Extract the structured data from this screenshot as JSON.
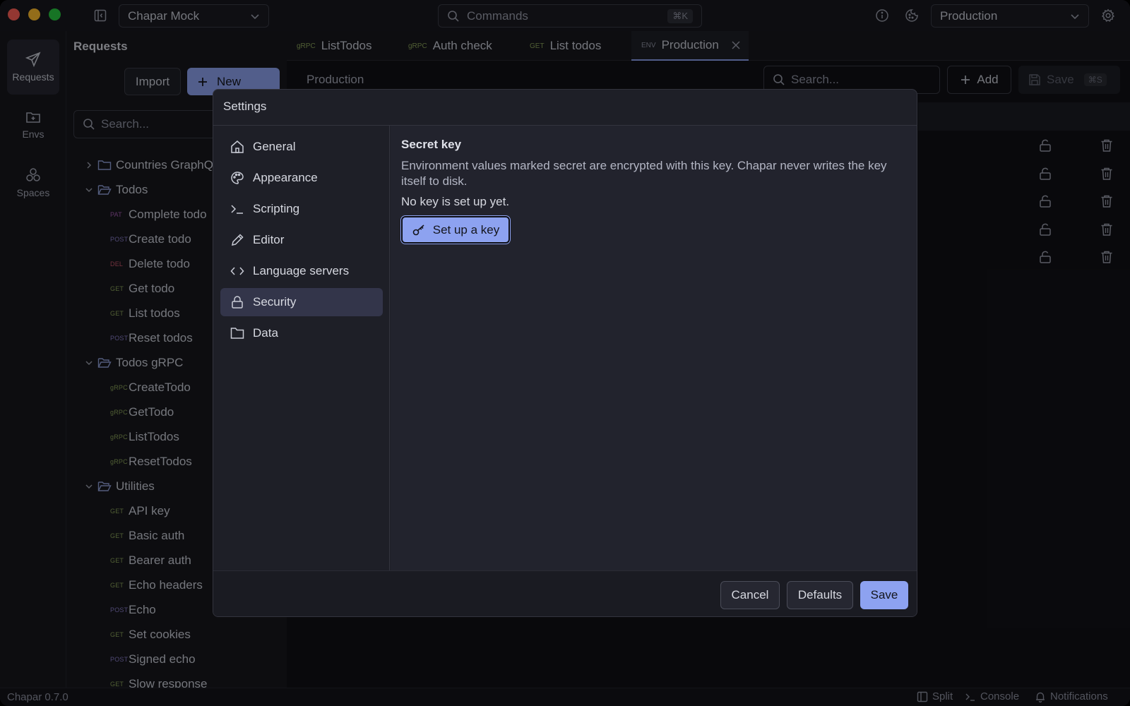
{
  "app": {
    "workspace": "Chapar Mock",
    "command_placeholder": "Commands",
    "command_shortcut": "⌘K",
    "environment": "Production",
    "version": "Chapar 0.7.0"
  },
  "rail": {
    "items": [
      {
        "label": "Requests",
        "icon": "send-icon"
      },
      {
        "label": "Envs",
        "icon": "folder-plus-icon"
      },
      {
        "label": "Spaces",
        "icon": "spaces-icon"
      }
    ]
  },
  "requests": {
    "title": "Requests",
    "import_label": "Import",
    "new_label": "New",
    "search_placeholder": "Search...",
    "tree": [
      {
        "type": "folder",
        "name": "Countries GraphQL",
        "expanded": false
      },
      {
        "type": "folder",
        "name": "Todos",
        "expanded": true
      },
      {
        "type": "leaf",
        "method": "PAT",
        "name": "Complete todo"
      },
      {
        "type": "leaf",
        "method": "POST",
        "name": "Create todo"
      },
      {
        "type": "leaf",
        "method": "DEL",
        "name": "Delete todo"
      },
      {
        "type": "leaf",
        "method": "GET",
        "name": "Get todo"
      },
      {
        "type": "leaf",
        "method": "GET",
        "name": "List todos"
      },
      {
        "type": "leaf",
        "method": "POST",
        "name": "Reset todos"
      },
      {
        "type": "folder",
        "name": "Todos gRPC",
        "expanded": true
      },
      {
        "type": "leaf",
        "method": "gRPC",
        "name": "CreateTodo"
      },
      {
        "type": "leaf",
        "method": "gRPC",
        "name": "GetTodo"
      },
      {
        "type": "leaf",
        "method": "gRPC",
        "name": "ListTodos"
      },
      {
        "type": "leaf",
        "method": "gRPC",
        "name": "ResetTodos"
      },
      {
        "type": "folder",
        "name": "Utilities",
        "expanded": true
      },
      {
        "type": "leaf",
        "method": "GET",
        "name": "API key"
      },
      {
        "type": "leaf",
        "method": "GET",
        "name": "Basic auth"
      },
      {
        "type": "leaf",
        "method": "GET",
        "name": "Bearer auth"
      },
      {
        "type": "leaf",
        "method": "GET",
        "name": "Echo headers"
      },
      {
        "type": "leaf",
        "method": "POST",
        "name": "Echo"
      },
      {
        "type": "leaf",
        "method": "GET",
        "name": "Set cookies"
      },
      {
        "type": "leaf",
        "method": "POST",
        "name": "Signed echo"
      },
      {
        "type": "leaf",
        "method": "GET",
        "name": "Slow response"
      }
    ]
  },
  "tabs": [
    {
      "method": "gRPC",
      "label": "ListTodos"
    },
    {
      "method": "gRPC",
      "label": "Auth check"
    },
    {
      "method": "GET",
      "label": "List todos"
    },
    {
      "method": "ENV",
      "label": "Production",
      "active": true
    }
  ],
  "main": {
    "env_name": "Production",
    "search_placeholder": "Search...",
    "add_label": "Add",
    "save_label": "Save",
    "save_shortcut": "⌘S"
  },
  "statusbar": {
    "split": "Split",
    "console": "Console",
    "notifications": "Notifications"
  },
  "settings": {
    "title": "Settings",
    "nav": [
      {
        "label": "General",
        "icon": "home-icon"
      },
      {
        "label": "Appearance",
        "icon": "palette-icon"
      },
      {
        "label": "Scripting",
        "icon": "terminal-icon"
      },
      {
        "label": "Editor",
        "icon": "pencil-icon"
      },
      {
        "label": "Language servers",
        "icon": "code-icon"
      },
      {
        "label": "Security",
        "icon": "lock-icon",
        "active": true
      },
      {
        "label": "Data",
        "icon": "folder-icon"
      }
    ],
    "section_title": "Secret key",
    "section_desc": "Environment values marked secret are encrypted with this key. Chapar never writes the key itself to disk.",
    "status": "No key is set up yet.",
    "setup_label": "Set up a key",
    "cancel_label": "Cancel",
    "defaults_label": "Defaults",
    "save_label": "Save"
  },
  "colors": {
    "accent": "#8da2f0",
    "background": "#141419",
    "dialog": "#1e1f27"
  }
}
